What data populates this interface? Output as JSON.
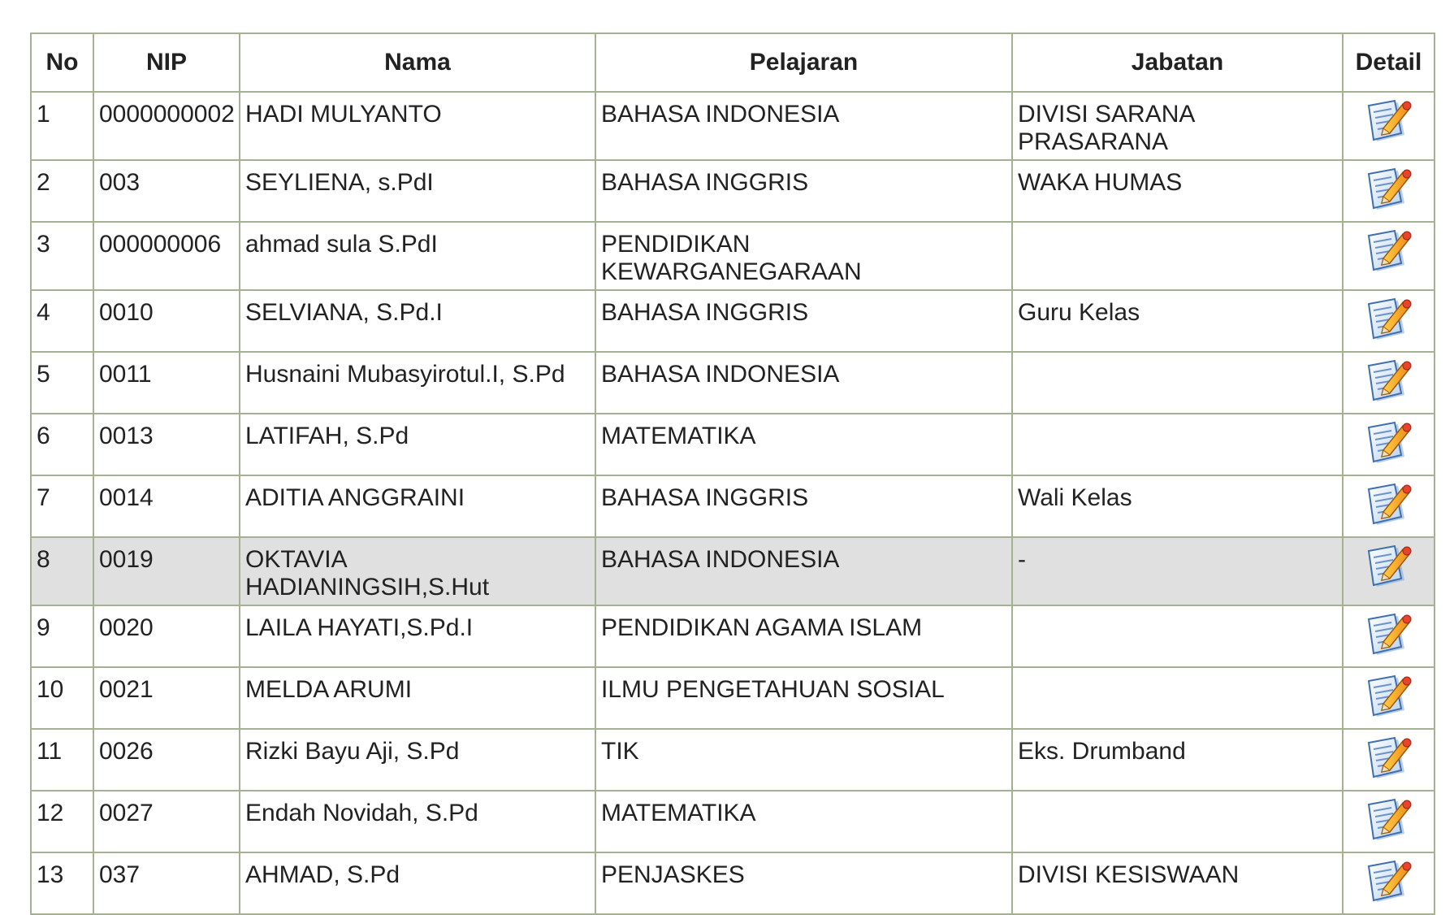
{
  "table": {
    "headers": {
      "no": "No",
      "nip": "NIP",
      "nama": "Nama",
      "pelajaran": "Pelajaran",
      "jabatan": "Jabatan",
      "detail": "Detail"
    },
    "detail_icon": "edit-document-icon",
    "highlight_row": 8,
    "colors": {
      "border": "#a6b093",
      "highlight_bg": "#e0e0e0"
    },
    "rows": [
      {
        "no": "1",
        "nip": "0000000002",
        "nama": "HADI MULYANTO",
        "pelajaran": "BAHASA INDONESIA",
        "jabatan": "DIVISI SARANA PRASARANA"
      },
      {
        "no": "2",
        "nip": "003",
        "nama": "SEYLIENA, s.PdI",
        "pelajaran": "BAHASA INGGRIS",
        "jabatan": "WAKA HUMAS"
      },
      {
        "no": "3",
        "nip": "000000006",
        "nama": "ahmad sula S.PdI",
        "pelajaran": "PENDIDIKAN KEWARGANEGARAAN",
        "jabatan": ""
      },
      {
        "no": "4",
        "nip": "0010",
        "nama": "SELVIANA, S.Pd.I",
        "pelajaran": "BAHASA INGGRIS",
        "jabatan": "Guru Kelas"
      },
      {
        "no": "5",
        "nip": "0011",
        "nama": "Husnaini Mubasyirotul.I, S.Pd",
        "pelajaran": "BAHASA INDONESIA",
        "jabatan": ""
      },
      {
        "no": "6",
        "nip": "0013",
        "nama": "LATIFAH, S.Pd",
        "pelajaran": "MATEMATIKA",
        "jabatan": ""
      },
      {
        "no": "7",
        "nip": "0014",
        "nama": "ADITIA ANGGRAINI",
        "pelajaran": "BAHASA INGGRIS",
        "jabatan": "Wali Kelas"
      },
      {
        "no": "8",
        "nip": "0019",
        "nama": "OKTAVIA HADIANINGSIH,S.Hut",
        "pelajaran": "BAHASA INDONESIA",
        "jabatan": "-"
      },
      {
        "no": "9",
        "nip": "0020",
        "nama": "LAILA HAYATI,S.Pd.I",
        "pelajaran": "PENDIDIKAN AGAMA ISLAM",
        "jabatan": ""
      },
      {
        "no": "10",
        "nip": "0021",
        "nama": "MELDA ARUMI",
        "pelajaran": "ILMU PENGETAHUAN SOSIAL",
        "jabatan": ""
      },
      {
        "no": "11",
        "nip": "0026",
        "nama": "Rizki Bayu Aji, S.Pd",
        "pelajaran": "TIK",
        "jabatan": "Eks. Drumband"
      },
      {
        "no": "12",
        "nip": "0027",
        "nama": "Endah Novidah, S.Pd",
        "pelajaran": "MATEMATIKA",
        "jabatan": ""
      },
      {
        "no": "13",
        "nip": "037",
        "nama": "AHMAD, S.Pd",
        "pelajaran": "PENJASKES",
        "jabatan": "DIVISI KESISWAAN"
      }
    ]
  }
}
